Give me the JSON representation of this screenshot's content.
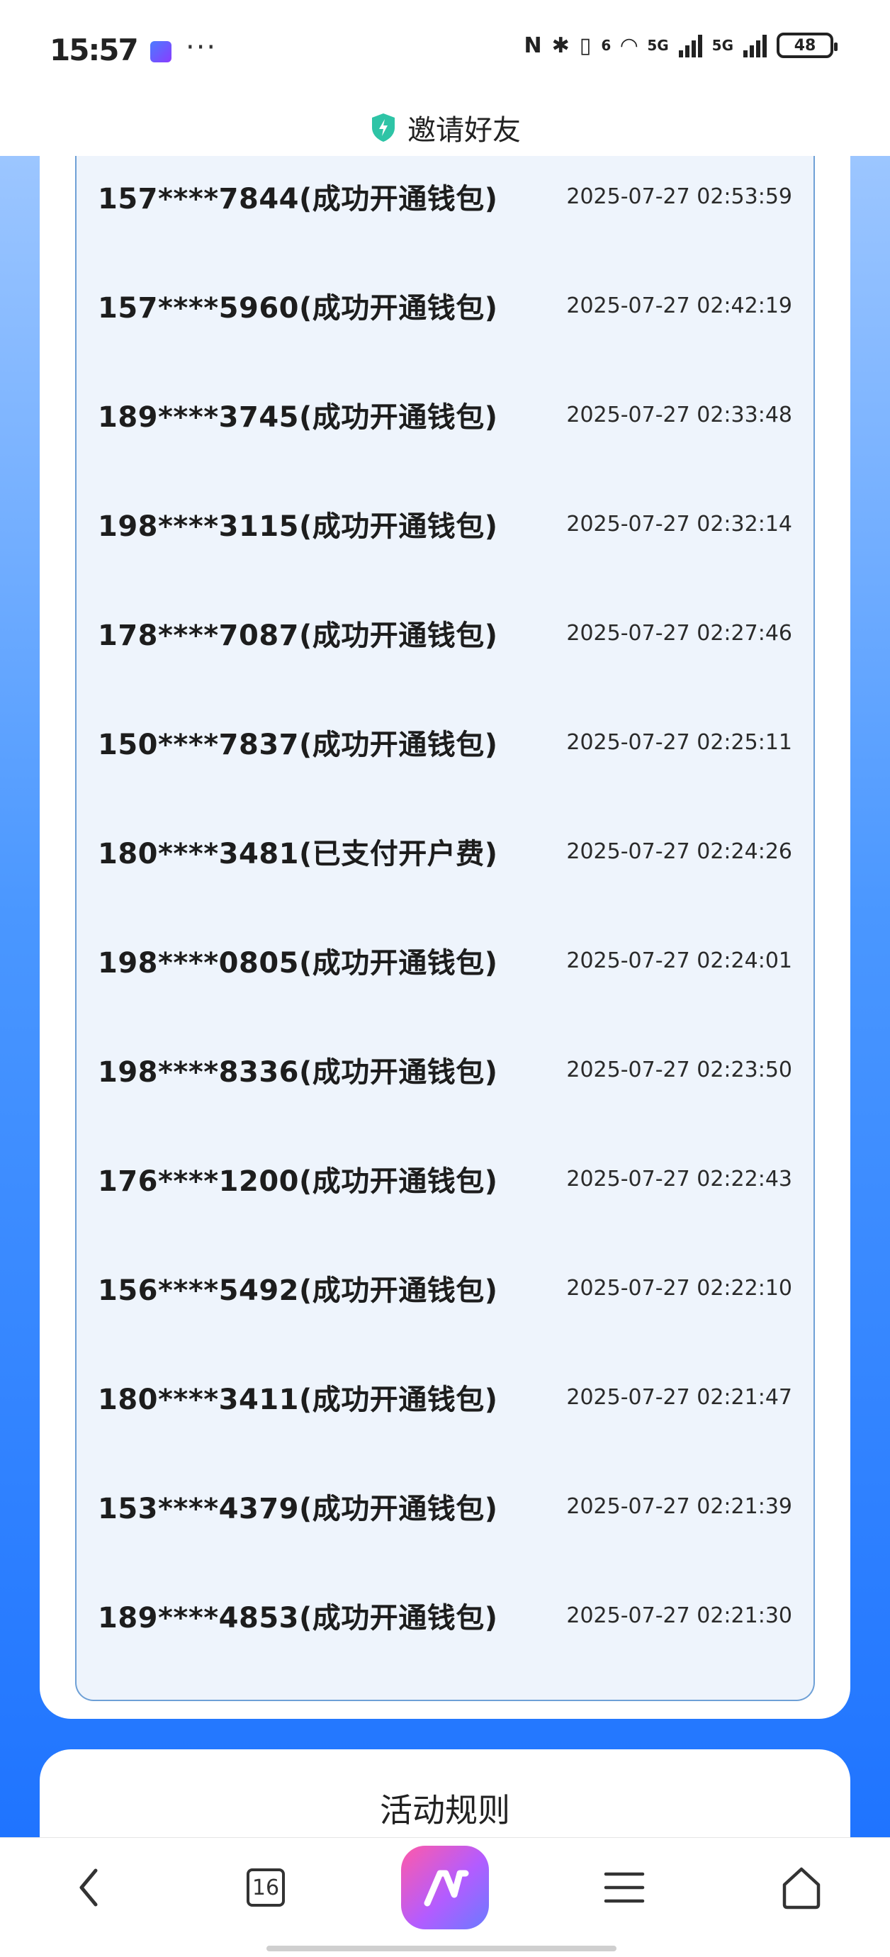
{
  "status_bar": {
    "time": "15:57",
    "network_1": "5G",
    "network_2": "5G",
    "wifi_tag": "6",
    "battery": "48"
  },
  "header": {
    "title": "邀请好友"
  },
  "invite_list": [
    {
      "name": "157****7844(成功开通钱包)",
      "time": "2025-07-27 02:53:59"
    },
    {
      "name": "157****5960(成功开通钱包)",
      "time": "2025-07-27 02:42:19"
    },
    {
      "name": "189****3745(成功开通钱包)",
      "time": "2025-07-27 02:33:48"
    },
    {
      "name": "198****3115(成功开通钱包)",
      "time": "2025-07-27 02:32:14"
    },
    {
      "name": "178****7087(成功开通钱包)",
      "time": "2025-07-27 02:27:46"
    },
    {
      "name": "150****7837(成功开通钱包)",
      "time": "2025-07-27 02:25:11"
    },
    {
      "name": "180****3481(已支付开户费)",
      "time": "2025-07-27 02:24:26"
    },
    {
      "name": "198****0805(成功开通钱包)",
      "time": "2025-07-27 02:24:01"
    },
    {
      "name": "198****8336(成功开通钱包)",
      "time": "2025-07-27 02:23:50"
    },
    {
      "name": "176****1200(成功开通钱包)",
      "time": "2025-07-27 02:22:43"
    },
    {
      "name": "156****5492(成功开通钱包)",
      "time": "2025-07-27 02:22:10"
    },
    {
      "name": "180****3411(成功开通钱包)",
      "time": "2025-07-27 02:21:47"
    },
    {
      "name": "153****4379(成功开通钱包)",
      "time": "2025-07-27 02:21:39"
    },
    {
      "name": "189****4853(成功开通钱包)",
      "time": "2025-07-27 02:21:30"
    }
  ],
  "rules": {
    "title": "活动规则"
  },
  "bottom_nav": {
    "tab_count": "16",
    "icons": [
      "back-icon",
      "tabs-icon",
      "app-logo-icon",
      "menu-icon",
      "home-icon"
    ]
  },
  "colors": {
    "background_top": "#9cc6ff",
    "background_bottom": "#1f74ff",
    "list_bg": "#eef4fc",
    "list_border": "#6ea0d6",
    "shield": "#2ec4a6"
  }
}
